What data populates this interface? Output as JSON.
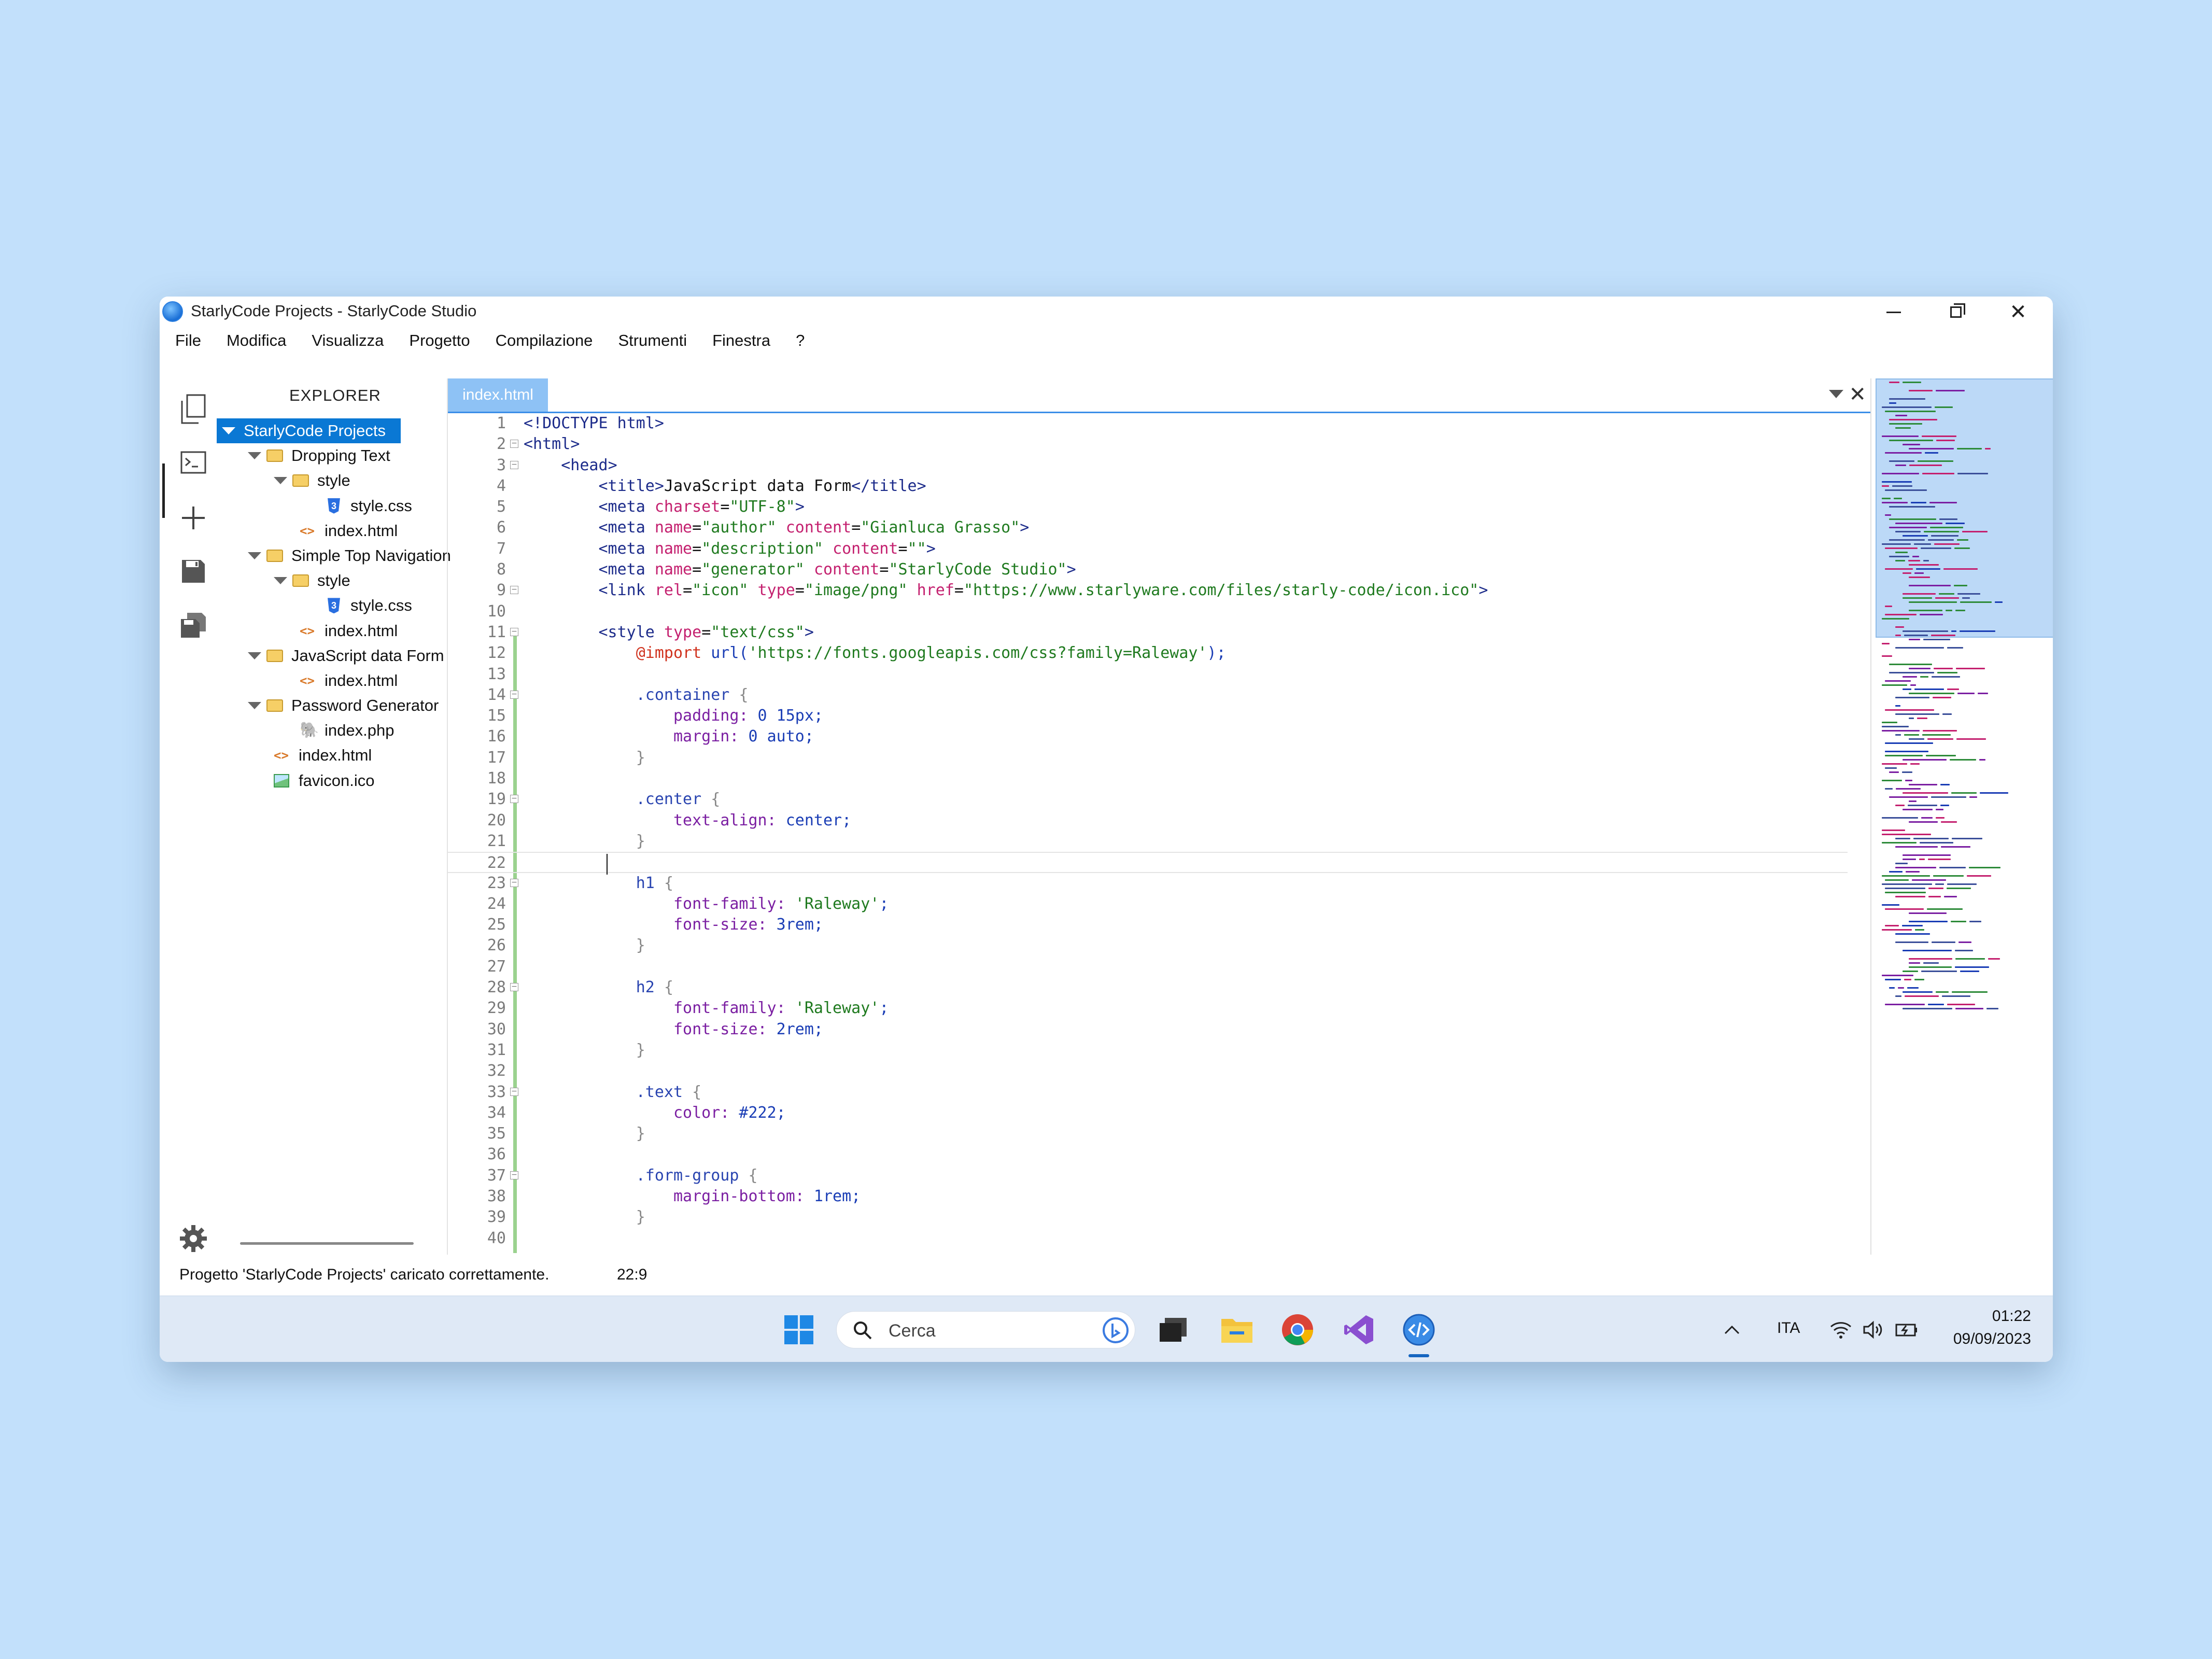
{
  "window": {
    "title": "StarlyCode Projects - StarlyCode Studio",
    "controls": [
      "minimize-icon",
      "restore-icon",
      "close-icon"
    ]
  },
  "menu": [
    "File",
    "Modifica",
    "Visualizza",
    "Progetto",
    "Compilazione",
    "Strumenti",
    "Finestra",
    "?"
  ],
  "activity_bar": [
    "files-icon",
    "terminal-icon",
    "plus-icon",
    "save-icon",
    "save-all-icon",
    "gear-icon"
  ],
  "explorer": {
    "title": "EXPLORER",
    "tree": [
      {
        "label": "StarlyCode Projects",
        "icon": "none",
        "expanded": true,
        "selected": true
      },
      {
        "label": "Dropping Text",
        "icon": "folder"
      },
      {
        "label": "style",
        "icon": "folder"
      },
      {
        "label": "style.css",
        "icon": "css"
      },
      {
        "label": "index.html",
        "icon": "html"
      },
      {
        "label": "Simple Top Navigation",
        "icon": "folder"
      },
      {
        "label": "style",
        "icon": "folder"
      },
      {
        "label": "style.css",
        "icon": "css"
      },
      {
        "label": "index.html",
        "icon": "html"
      },
      {
        "label": "JavaScript data Form",
        "icon": "folder"
      },
      {
        "label": "index.html",
        "icon": "html"
      },
      {
        "label": "Password Generator",
        "icon": "folder"
      },
      {
        "label": "index.php",
        "icon": "php"
      },
      {
        "label": "index.html",
        "icon": "html"
      },
      {
        "label": "favicon.ico",
        "icon": "image"
      }
    ]
  },
  "editor": {
    "active_tab": "index.html",
    "lines": [
      "<!DOCTYPE html>",
      "<html>",
      "    <head>",
      "        <title>JavaScript data Form</title>",
      "        <meta charset=\"UTF-8\">",
      "        <meta name=\"author\" content=\"Gianluca Grasso\">",
      "        <meta name=\"description\" content=\"\">",
      "        <meta name=\"generator\" content=\"StarlyCode Studio\">",
      "        <link rel=\"icon\" type=\"image/png\" href=\"https://www.starlyware.com/files/starly-code/icon.ico\">",
      "",
      "        <style type=\"text/css\">",
      "            @import url('https://fonts.googleapis.com/css?family=Raleway');",
      "",
      "            .container {",
      "                padding: 0 15px;",
      "                margin: 0 auto;",
      "            }",
      "",
      "            .center {",
      "                text-align: center;",
      "            }",
      "",
      "            h1 {",
      "                font-family: 'Raleway';",
      "                font-size: 3rem;",
      "            }",
      "",
      "            h2 {",
      "                font-family: 'Raleway';",
      "                font-size: 2rem;",
      "            }",
      "",
      "            .text {",
      "                color: #222;",
      "            }",
      "",
      "            .form-group {",
      "                margin-bottom: 1rem;",
      "            }",
      ""
    ],
    "line_numbers": [
      "1",
      "2",
      "3",
      "4",
      "5",
      "6",
      "7",
      "8",
      "9",
      "10",
      "11",
      "12",
      "13",
      "14",
      "15",
      "16",
      "17",
      "18",
      "19",
      "20",
      "21",
      "22",
      "23",
      "24",
      "25",
      "26",
      "27",
      "28",
      "29",
      "30",
      "31",
      "32",
      "33",
      "34",
      "35",
      "36",
      "37",
      "38",
      "39",
      "40"
    ],
    "current_line": 22
  },
  "statusbar": {
    "message": "Progetto 'StarlyCode Projects' caricato correttamente.",
    "position": "22:9"
  },
  "taskbar": {
    "apps": [
      "windows-start-icon",
      "search-icon",
      "bing-icon",
      "task-view-icon",
      "file-explorer-icon",
      "chrome-icon",
      "visual-studio-icon",
      "starlycode-studio-icon"
    ],
    "search_placeholder": "Cerca",
    "language": "ITA",
    "tray": [
      "chevron-up-icon",
      "wifi-icon",
      "volume-icon",
      "battery-icon"
    ],
    "time": "01:22",
    "date": "09/09/2023"
  }
}
